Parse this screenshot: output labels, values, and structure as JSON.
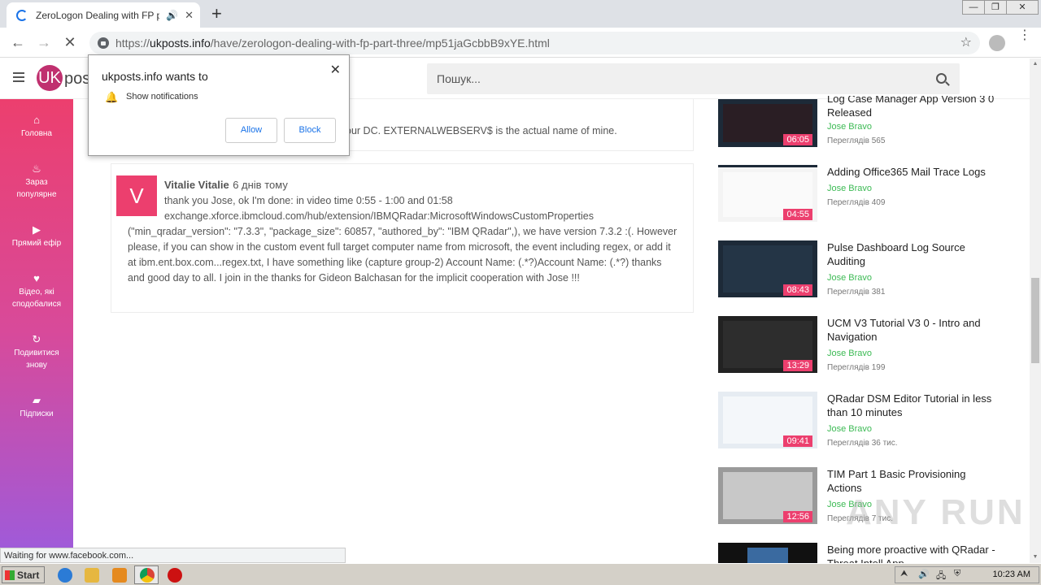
{
  "browser": {
    "tab_title": "ZeroLogon Dealing with FP part",
    "url_scheme": "https://",
    "url_host": "ukposts.info",
    "url_path": "/have/zerologon-dealing-with-fp-part-three/mp51jaGcbbB9xYE.html",
    "status": "Waiting for www.facebook.com..."
  },
  "site": {
    "logo_mark": "UK",
    "logo_text": "posts",
    "search_placeholder": "Пошук..."
  },
  "sidebar": {
    "items": [
      {
        "icon": "⌂",
        "label": "Головна"
      },
      {
        "icon": "♨",
        "label": "Зараз популярне"
      },
      {
        "icon": "▶",
        "label": "Прямий ефір"
      },
      {
        "icon": "♥",
        "label": "Відео, які сподобалися"
      },
      {
        "icon": "↻",
        "label": "Подивитися знову"
      },
      {
        "icon": "▰",
        "label": "Підписки"
      }
    ]
  },
  "popup": {
    "title": "ukposts.info wants to",
    "permission": "Show notifications",
    "allow": "Allow",
    "block": "Block"
  },
  "comments": [
    {
      "text": "our DC. EXTERNALWEBSERV$ is the actual name of mine."
    },
    {
      "avatar": "V",
      "author": "Vitalie Vitalie",
      "time": "6 днів тому",
      "line1": "thank you Jose, ok I'm done: in video time 0:55 - 1:00 and 01:58",
      "line2": "exchange.xforce.ibmcloud.com/hub/extension/IBMQRadar:MicrosoftWindowsCustomProperties",
      "rest": "(\"min_qradar_version\": \"7.3.3\", \"package_size\": 60857, \"authored_by\": \"IBM QRadar\",), we have version 7.3.2 :(. However please, if you can show in the custom event full target computer name from microsoft, the event including regex, or add it at ibm.ent.box.com...regex.txt, I have something like (capture group-2) Account Name: (.*?)Account Name: (.*?) thanks and good day to all. I join in the thanks for Gideon Balchasan for the implicit cooperation with Jose !!!"
    }
  ],
  "videos": [
    {
      "title": "Log Case Manager App Version 3 0 Released",
      "channel": "Jose Bravo",
      "views": "Переглядів 565",
      "duration": "06:05"
    },
    {
      "title": "Adding Office365 Mail Trace Logs",
      "channel": "Jose Bravo",
      "views": "Переглядів 409",
      "duration": "04:55"
    },
    {
      "title": "Pulse Dashboard Log Source Auditing",
      "channel": "Jose Bravo",
      "views": "Переглядів 381",
      "duration": "08:43"
    },
    {
      "title": "UCM V3 Tutorial V3 0 - Intro and Navigation",
      "channel": "Jose Bravo",
      "views": "Переглядів 199",
      "duration": "13:29"
    },
    {
      "title": "QRadar DSM Editor Tutorial in less than 10 minutes",
      "channel": "Jose Bravo",
      "views": "Переглядів 36 тис.",
      "duration": "09:41"
    },
    {
      "title": "TIM Part 1 Basic Provisioning Actions",
      "channel": "Jose Bravo",
      "views": "Переглядів 7 тис.",
      "duration": "12:56"
    },
    {
      "title": "Being more proactive with QRadar - Threat Intell App",
      "channel": "Jose Bravo",
      "views": "",
      "duration": ""
    }
  ],
  "taskbar": {
    "start": "Start",
    "clock": "10:23 AM"
  },
  "watermark": "ANY RUN",
  "colors": {
    "accent": "#ec3f6e",
    "channel": "#3cba54",
    "link": "#1a73e8"
  }
}
